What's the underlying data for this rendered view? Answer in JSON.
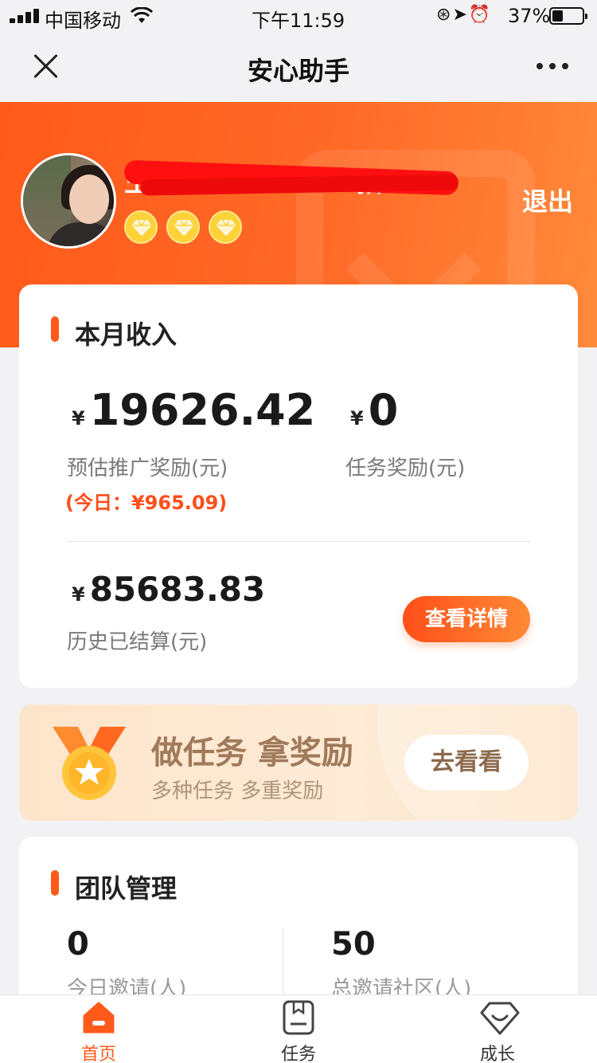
{
  "status_bar": {
    "carrier": "中国移动",
    "time": "下午11:59",
    "battery_percent": "37%",
    "battery_level": 0.37,
    "icons": [
      "signal-icon",
      "wifi-icon",
      "rotation-lock-icon",
      "location-icon",
      "alarm-icon",
      "battery-icon"
    ]
  },
  "nav": {
    "title": "安心助手",
    "close_icon": "close-icon",
    "more_icon": "more-icon"
  },
  "profile": {
    "username": "王桂红1387·······6招…",
    "diamond_count": 3,
    "logout_label": "退出",
    "colors": {
      "header_start": "#ff5a1a",
      "header_end": "#ff8a3a"
    }
  },
  "income": {
    "title": "本月收入",
    "currency": "¥",
    "estimated_promo_reward": "19626.42",
    "estimated_promo_label": "预估推广奖励(元)",
    "today_note": "(今日：¥965.09)",
    "task_reward": "0",
    "task_reward_label": "任务奖励(元)",
    "history_settled": "85683.83",
    "history_settled_label": "历史已结算(元)",
    "detail_button": "查看详情"
  },
  "task_banner": {
    "title": "做任务 拿奖励",
    "subtitle": "多种任务 多重奖励",
    "button": "去看看"
  },
  "team": {
    "title": "团队管理",
    "today_invites": "0",
    "today_invites_label": "今日邀请(人)",
    "total_invites": "50",
    "total_invites_label": "总邀请社区(人)"
  },
  "tabbar": {
    "items": [
      {
        "label": "首页",
        "icon": "home-icon",
        "active": true
      },
      {
        "label": "任务",
        "icon": "task-icon",
        "active": false
      },
      {
        "label": "成长",
        "icon": "growth-icon",
        "active": false
      }
    ],
    "accent": "#ff5a1a"
  }
}
